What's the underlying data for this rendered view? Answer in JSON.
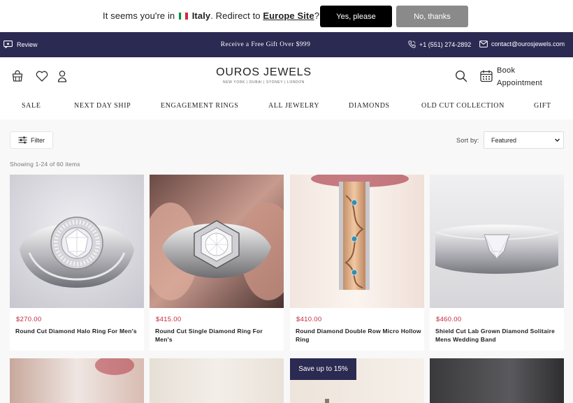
{
  "geo_banner": {
    "message_prefix": "It seems you're in",
    "country": "Italy",
    "redirect_text": ". Redirect to",
    "site_link": "Europe Site",
    "suffix": "?",
    "yes_label": "Yes, please",
    "no_label": "No, thanks",
    "flag_colors": [
      "#009246",
      "#ffffff",
      "#ce2b37"
    ]
  },
  "announcement": {
    "review_label": "Review",
    "promo": "Receive a Free Gift Over $999",
    "phone": "+1 (551) 274-2892",
    "email": "contact@ourosjewels.com",
    "background": "#2b2a52"
  },
  "header": {
    "logo_name": "OUROS JEWELS",
    "logo_tagline": "NEW YORK | DUBAI | SYDNEY | LONDON",
    "book_line1": "Book",
    "book_line2": "Appointment",
    "icons": [
      "bag-icon",
      "heart-icon",
      "user-icon",
      "search-icon",
      "calendar-icon"
    ]
  },
  "nav": {
    "items": [
      "SALE",
      "NEXT DAY SHIP",
      "ENGAGEMENT RINGS",
      "ALL JEWELRY",
      "DIAMONDS",
      "OLD CUT COLLECTION",
      "GIFT"
    ]
  },
  "toolbar": {
    "filter_label": "Filter",
    "sort_label": "Sort by:",
    "sort_value": "Featured",
    "count_text": "Showing 1-24 of 60 items"
  },
  "products": [
    {
      "price": "$270.00",
      "title": "Round Cut Diamond Halo Ring For Men's",
      "watermark": "OUROS JEWELS"
    },
    {
      "price": "$415.00",
      "title": "Round Cut Single Diamond Ring For Men's",
      "watermark": ""
    },
    {
      "price": "$410.00",
      "title": "Round Diamond Double Row Micro Hollow Ring",
      "watermark": ""
    },
    {
      "price": "$460.00",
      "title": "Shield Cut Lab Grown Diamond Solitaire Mens Wedding Band",
      "watermark": ""
    }
  ],
  "second_row": {
    "badge": "Save up to 15%"
  },
  "colors": {
    "price": "#c3273a",
    "brand_navy": "#2b2a52"
  }
}
